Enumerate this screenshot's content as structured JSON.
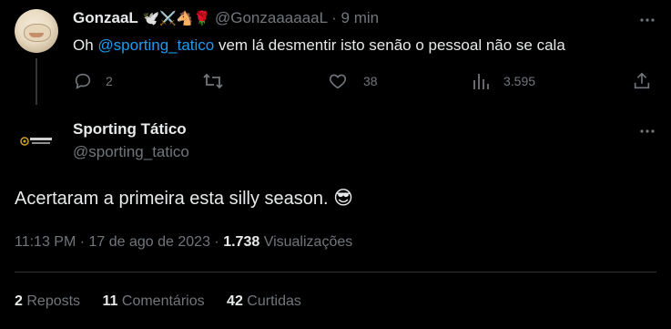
{
  "reply": {
    "name": "GonzaaL",
    "emoji_badges": "🕊️⚔️🐴🌹",
    "handle": "@GonzaaaaaaL",
    "time": "· 9 min",
    "text_prefix": "Oh ",
    "mention": "@sporting_tatico",
    "text_suffix": " vem lá desmentir isto senão o pessoal não se cala",
    "replies": "2",
    "likes": "38",
    "views": "3.595"
  },
  "main": {
    "name": "Sporting Tático",
    "handle": "@sporting_tatico",
    "avatar_text": "SPORTING TÁTICO",
    "text": "Acertaram a primeira esta silly season.",
    "emoji": "😎",
    "timestamp": "11:13 PM · 17 de ago de 2023 · ",
    "view_count": "1.738",
    "view_label": " Visualizações",
    "stats": [
      {
        "count": "2",
        "label": "Reposts"
      },
      {
        "count": "11",
        "label": "Comentários"
      },
      {
        "count": "42",
        "label": "Curtidas"
      }
    ]
  },
  "colors": {
    "background": "#000000",
    "text": "#e7e9ea",
    "muted": "#71767b",
    "link": "#1d9bf0",
    "divider": "#2f3336"
  },
  "icons": [
    "more-icon",
    "reply-icon",
    "retweet-icon",
    "like-icon",
    "views-icon",
    "share-icon"
  ]
}
